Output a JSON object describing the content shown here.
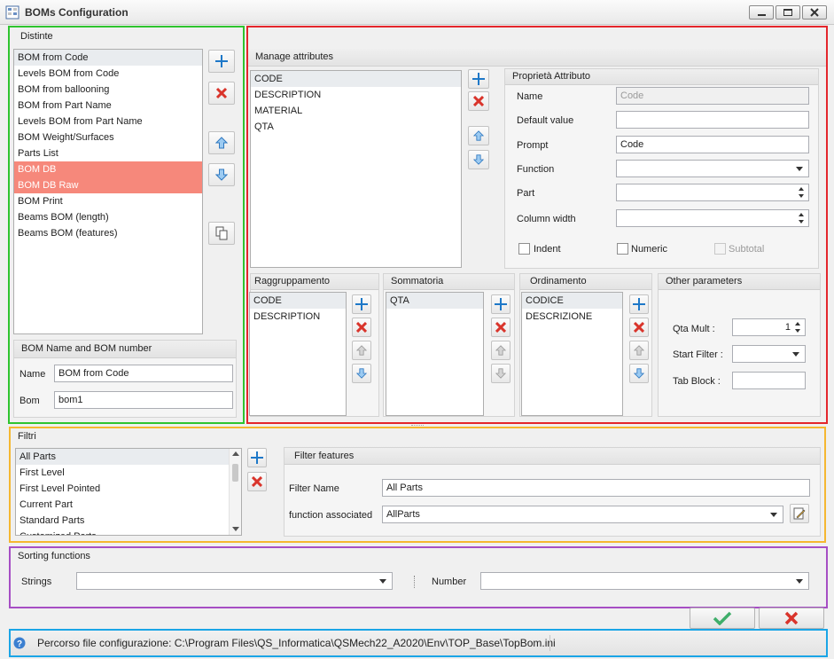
{
  "window": {
    "title": "BOMs Configuration"
  },
  "distinte": {
    "header": "Distinte",
    "items": [
      "BOM from Code",
      "Levels BOM from Code",
      "BOM from ballooning",
      "BOM from Part Name",
      "Levels BOM from Part Name",
      "BOM Weight/Surfaces",
      "Parts List",
      "BOM DB",
      "BOM DB Raw",
      "BOM Print",
      "Beams BOM (length)",
      "Beams BOM (features)"
    ],
    "selected": [
      "BOM DB",
      "BOM DB Raw"
    ]
  },
  "bom_name": {
    "header": "BOM Name and BOM number",
    "name_label": "Name",
    "name_value": "BOM from Code",
    "bom_label": "Bom",
    "bom_value": "bom1"
  },
  "manage": {
    "header": "Manage attributes",
    "items": [
      "CODE",
      "DESCRIPTION",
      "MATERIAL",
      "QTA"
    ]
  },
  "proprieta": {
    "header": "Proprietà Attributo",
    "name_label": "Name",
    "name_value": "Code",
    "default_label": "Default value",
    "default_value": "",
    "prompt_label": "Prompt",
    "prompt_value": "Code",
    "function_label": "Function",
    "function_value": "",
    "part_label": "Part",
    "part_value": "",
    "colwidth_label": "Column width",
    "colwidth_value": "",
    "indent_label": "Indent",
    "numeric_label": "Numeric",
    "subtotal_label": "Subtotal"
  },
  "raggruppamento": {
    "header": "Raggruppamento",
    "items": [
      "CODE",
      "DESCRIPTION"
    ]
  },
  "sommatoria": {
    "header": "Sommatoria",
    "items": [
      "QTA"
    ]
  },
  "ordinamento": {
    "header": "Ordinamento",
    "items": [
      "CODICE",
      "DESCRIZIONE"
    ]
  },
  "other": {
    "header": "Other parameters",
    "qta_label": "Qta Mult :",
    "qta_value": "1",
    "start_label": "Start Filter :",
    "start_value": "",
    "tab_label": "Tab Block :",
    "tab_value": ""
  },
  "filtri": {
    "header": "Filtri",
    "items": [
      "All Parts",
      "First Level",
      "First Level Pointed",
      "Current Part",
      "Standard Parts",
      "Customized Parts"
    ]
  },
  "filter_features": {
    "header": "Filter features",
    "name_label": "Filter Name",
    "name_value": "All Parts",
    "func_label": "function associated",
    "func_value": "AllParts"
  },
  "sorting": {
    "header": "Sorting functions",
    "strings_label": "Strings",
    "strings_value": "",
    "number_label": "Number",
    "number_value": ""
  },
  "status": {
    "text": "Percorso file configurazione: C:\\Program Files\\QS_Informatica\\QSMech22_A2020\\Env\\TOP_Base\\TopBom.ini"
  },
  "colors": {
    "green": "#2fc42f",
    "red": "#e4262c",
    "orange": "#f5b731",
    "purple": "#a64ec4",
    "blue": "#1aa5e6",
    "selection": "#f6887b"
  }
}
